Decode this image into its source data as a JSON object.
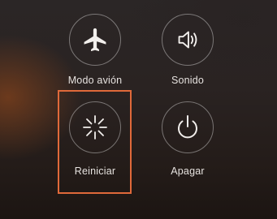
{
  "power_menu": {
    "items": [
      {
        "id": "airplane",
        "label": "Modo avión",
        "icon": "airplane-icon"
      },
      {
        "id": "sound",
        "label": "Sonido",
        "icon": "speaker-icon"
      },
      {
        "id": "restart",
        "label": "Reiniciar",
        "icon": "restart-icon"
      },
      {
        "id": "power-off",
        "label": "Apagar",
        "icon": "power-icon"
      }
    ]
  },
  "highlight": {
    "target": "restart",
    "color": "#e0693a"
  }
}
